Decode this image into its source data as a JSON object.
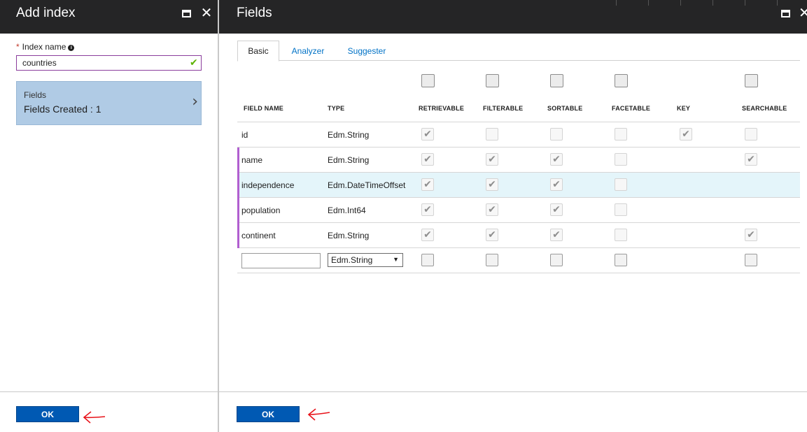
{
  "left_blade": {
    "title": "Add index",
    "index_name_label": "Index name",
    "index_name_value": "countries",
    "fields_tile": {
      "title": "Fields",
      "subtitle": "Fields Created : 1"
    },
    "ok_label": "OK"
  },
  "right_blade": {
    "title": "Fields",
    "tabs": [
      {
        "label": "Basic",
        "active": true
      },
      {
        "label": "Analyzer",
        "active": false
      },
      {
        "label": "Suggester",
        "active": false
      }
    ],
    "columns": [
      "FIELD NAME",
      "TYPE",
      "RETRIEVABLE",
      "FILTERABLE",
      "SORTABLE",
      "FACETABLE",
      "KEY",
      "SEARCHABLE"
    ],
    "rows": [
      {
        "name": "id",
        "type": "Edm.String"
      },
      {
        "name": "name",
        "type": "Edm.String"
      },
      {
        "name": "independence",
        "type": "Edm.DateTimeOffset"
      },
      {
        "name": "population",
        "type": "Edm.Int64"
      },
      {
        "name": "continent",
        "type": "Edm.String"
      }
    ],
    "new_row": {
      "name_value": "",
      "type_value": "Edm.String"
    },
    "ok_label": "OK"
  },
  "colors": {
    "header_bg": "#252526",
    "ok_button": "#0059b3",
    "tile_bg": "#b0cbe5",
    "row_marker": "#b15fd0",
    "row_highlight": "#e4f5fa",
    "valid_check": "#5db300",
    "annotation_arrow": "#e8131a"
  },
  "icons": {
    "maximize": "maximize-icon",
    "close": "close-icon",
    "info": "info-icon",
    "check": "check-icon",
    "chevron": "chevron-right-icon",
    "dropdown": "caret-down-icon"
  }
}
